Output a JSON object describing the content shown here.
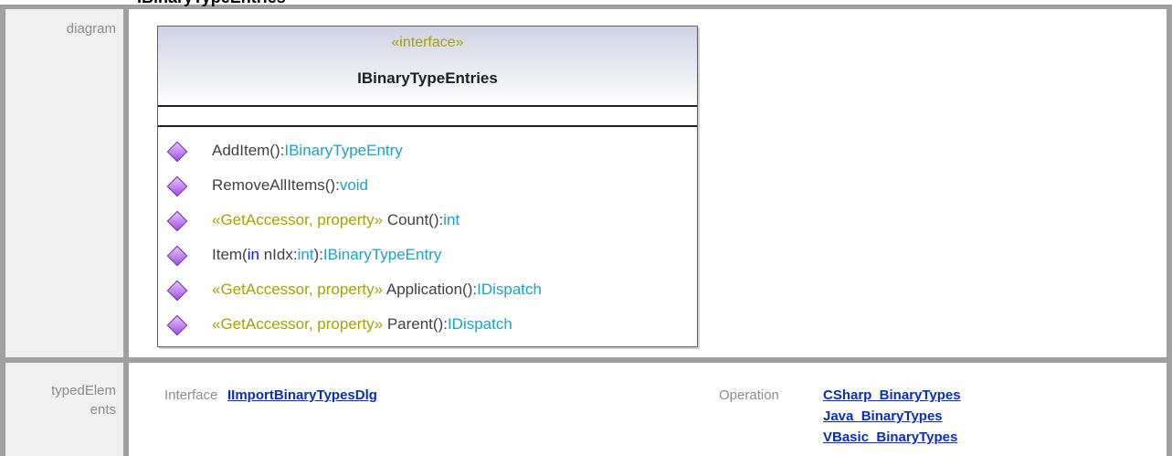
{
  "heading": "IBinaryTypeEntries",
  "rows": {
    "diagram_label": "diagram",
    "typed_label_line1": "typedElem",
    "typed_label_line2": "ents"
  },
  "uml": {
    "stereotype": "«interface»",
    "name": "IBinaryTypeEntries",
    "operations": [
      {
        "stereo": "",
        "name": "AddItem():",
        "type": "IBinaryTypeEntry"
      },
      {
        "stereo": "",
        "name": "RemoveAllItems():",
        "type": "void"
      },
      {
        "stereo": "«GetAccessor, property»",
        "name": " Count():",
        "type": "int"
      },
      {
        "stereo": "",
        "name": "Item(",
        "kw": "in",
        "rest": " nIdx:",
        "rest_type": "int",
        "close": "):",
        "type": "IBinaryTypeEntry"
      },
      {
        "stereo": "«GetAccessor, property»",
        "name": " Application():",
        "type": "IDispatch"
      },
      {
        "stereo": "«GetAccessor, property»",
        "name": " Parent():",
        "type": "IDispatch"
      }
    ]
  },
  "typed_elements": {
    "interface_label": "Interface",
    "interface_link": "IImportBinaryTypesDlg",
    "operation_label": "Operation",
    "operation_links": [
      "CSharp_BinaryTypes",
      "Java_BinaryTypes",
      "VBasic_BinaryTypes"
    ]
  },
  "colors": {
    "stereotype": "#a7a100",
    "type": "#1aa3c3",
    "keyword": "#1515e0",
    "link": "#0b2dbf",
    "label": "#8c8c8c"
  }
}
